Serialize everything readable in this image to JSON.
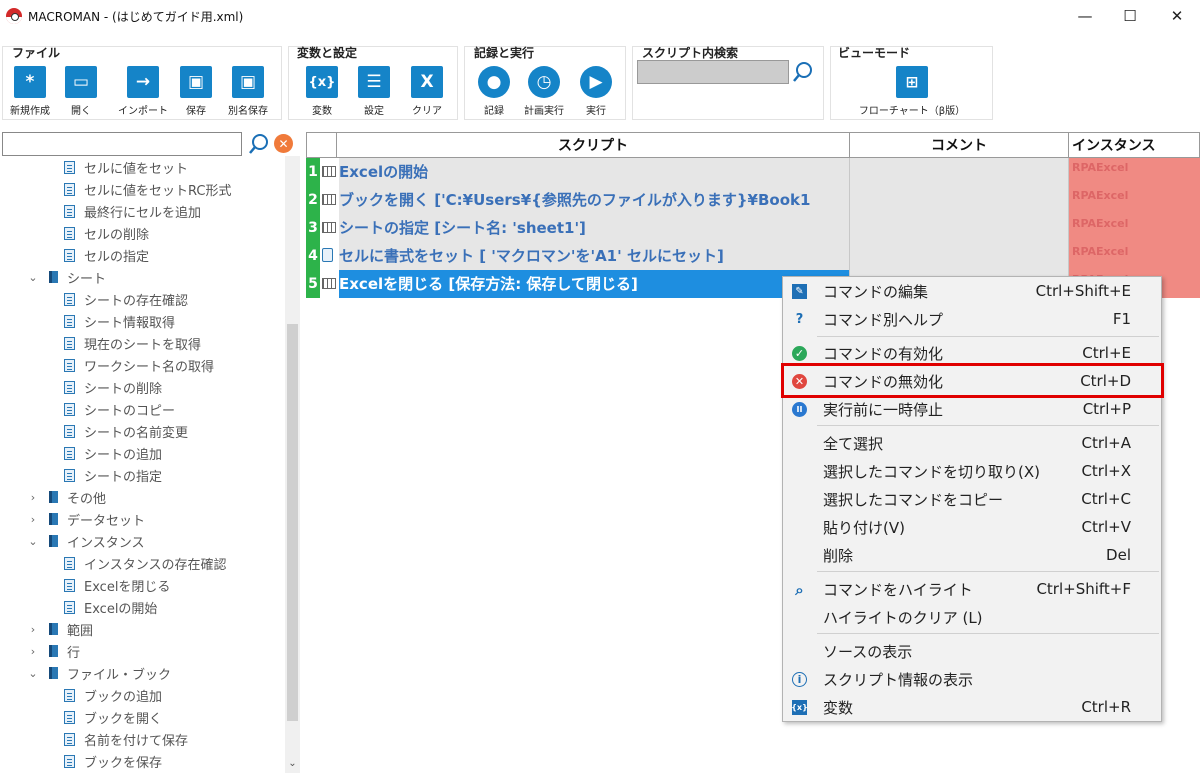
{
  "window": {
    "title": "MACROMAN - (はじめてガイド用.xml)",
    "controls": {
      "minimize": "—",
      "maximize": "☐",
      "close": "✕"
    }
  },
  "ribbon": {
    "groups": [
      {
        "title": "ファイル",
        "buttons": [
          {
            "label": "新規作成",
            "icon": "*"
          },
          {
            "label": "開く",
            "icon": "▭"
          },
          {
            "label": "インポート",
            "icon": "→"
          },
          {
            "label": "保存",
            "icon": "▣"
          },
          {
            "label": "別名保存",
            "icon": "▣"
          }
        ]
      },
      {
        "title": "変数と設定",
        "buttons": [
          {
            "label": "変数",
            "icon": "{x}"
          },
          {
            "label": "設定",
            "icon": "☰"
          },
          {
            "label": "クリア",
            "icon": "X"
          }
        ]
      },
      {
        "title": "記録と実行",
        "buttons": [
          {
            "label": "記録",
            "icon": "●"
          },
          {
            "label": "計画実行",
            "icon": "◷"
          },
          {
            "label": "実行",
            "icon": "▶"
          }
        ]
      },
      {
        "title": "スクリプト内検索"
      },
      {
        "title": "ビューモード",
        "buttons": [
          {
            "label": "フローチャート（β版）",
            "icon": "⊞"
          }
        ]
      }
    ]
  },
  "tree": {
    "items": [
      {
        "label": "セルに値をセット",
        "level": 2,
        "kind": "doc"
      },
      {
        "label": "セルに値をセットRC形式",
        "level": 2,
        "kind": "doc"
      },
      {
        "label": "最終行にセルを追加",
        "level": 2,
        "kind": "doc"
      },
      {
        "label": "セルの削除",
        "level": 2,
        "kind": "doc"
      },
      {
        "label": "セルの指定",
        "level": 2,
        "kind": "doc"
      },
      {
        "label": "シート",
        "level": 1,
        "kind": "folder",
        "arrow": "⌄"
      },
      {
        "label": "シートの存在確認",
        "level": 2,
        "kind": "doc"
      },
      {
        "label": "シート情報取得",
        "level": 2,
        "kind": "doc"
      },
      {
        "label": "現在のシートを取得",
        "level": 2,
        "kind": "doc"
      },
      {
        "label": "ワークシート名の取得",
        "level": 2,
        "kind": "doc"
      },
      {
        "label": "シートの削除",
        "level": 2,
        "kind": "doc"
      },
      {
        "label": "シートのコピー",
        "level": 2,
        "kind": "doc"
      },
      {
        "label": "シートの名前変更",
        "level": 2,
        "kind": "doc"
      },
      {
        "label": "シートの追加",
        "level": 2,
        "kind": "doc"
      },
      {
        "label": "シートの指定",
        "level": 2,
        "kind": "doc"
      },
      {
        "label": "その他",
        "level": 1,
        "kind": "folder",
        "arrow": "›"
      },
      {
        "label": "データセット",
        "level": 1,
        "kind": "folder",
        "arrow": "›"
      },
      {
        "label": "インスタンス",
        "level": 1,
        "kind": "folder",
        "arrow": "⌄"
      },
      {
        "label": "インスタンスの存在確認",
        "level": 2,
        "kind": "doc"
      },
      {
        "label": "Excelを閉じる",
        "level": 2,
        "kind": "doc"
      },
      {
        "label": "Excelの開始",
        "level": 2,
        "kind": "doc"
      },
      {
        "label": "範囲",
        "level": 1,
        "kind": "folder",
        "arrow": "›"
      },
      {
        "label": "行",
        "level": 1,
        "kind": "folder",
        "arrow": "›"
      },
      {
        "label": "ファイル・ブック",
        "level": 1,
        "kind": "folder",
        "arrow": "⌄"
      },
      {
        "label": "ブックの追加",
        "level": 2,
        "kind": "doc"
      },
      {
        "label": "ブックを開く",
        "level": 2,
        "kind": "doc"
      },
      {
        "label": "名前を付けて保存",
        "level": 2,
        "kind": "doc"
      },
      {
        "label": "ブックを保存",
        "level": 2,
        "kind": "doc"
      }
    ]
  },
  "grid": {
    "headers": {
      "script": "スクリプト",
      "comment": "コメント",
      "instance": "インスタンス"
    },
    "rows": [
      {
        "num": "1",
        "text": "Excelの開始",
        "instance": "RPAExcel",
        "icon": "grid"
      },
      {
        "num": "2",
        "text": "ブックを開く ['C:¥Users¥{参照先のファイルが入ります}¥Book1",
        "instance": "RPAExcel",
        "icon": "grid"
      },
      {
        "num": "3",
        "text": "シートの指定 [シート名: 'sheet1']",
        "instance": "RPAExcel",
        "icon": "grid"
      },
      {
        "num": "4",
        "text": "セルに書式をセット [ 'マクロマン'を'A1' セルにセット]",
        "instance": "RPAExcel",
        "icon": "doc"
      },
      {
        "num": "5",
        "text": "Excelを閉じる [保存方法: 保存して閉じる]",
        "instance": "RPAExcel",
        "icon": "grid",
        "selected": true
      }
    ]
  },
  "context_menu": {
    "items": [
      {
        "label": "コマンドの編集",
        "shortcut": "Ctrl+Shift+E",
        "icon": "edit-icon",
        "color": "#1e6fb5"
      },
      {
        "label": "コマンド別ヘルプ",
        "shortcut": "F1",
        "icon": "help-icon",
        "color": "#1e6fb5"
      },
      {
        "label": "コマンドの有効化",
        "shortcut": "Ctrl+E",
        "icon": "check-icon",
        "color": "#2ca85a"
      },
      {
        "label": "コマンドの無効化",
        "shortcut": "Ctrl+D",
        "icon": "disable-icon",
        "color": "#e0473f"
      },
      {
        "label": "実行前に一時停止",
        "shortcut": "Ctrl+P",
        "icon": "pause-icon",
        "color": "#2a78d0"
      },
      {
        "label": "全て選択",
        "shortcut": "Ctrl+A"
      },
      {
        "label": "選択したコマンドを切り取り(X)",
        "shortcut": "Ctrl+X"
      },
      {
        "label": "選択したコマンドをコピー",
        "shortcut": "Ctrl+C"
      },
      {
        "label": "貼り付け(V)",
        "shortcut": "Ctrl+V"
      },
      {
        "label": "削除",
        "shortcut": "Del"
      },
      {
        "label": "コマンドをハイライト",
        "shortcut": "Ctrl+Shift+F",
        "icon": "search-icon",
        "color": "#1e6fb5"
      },
      {
        "label": "ハイライトのクリア (L)",
        "shortcut": ""
      },
      {
        "label": "ソースの表示",
        "shortcut": ""
      },
      {
        "label": "スクリプト情報の表示",
        "shortcut": "",
        "icon": "info-icon",
        "color": "#1e6fb5"
      },
      {
        "label": "変数",
        "shortcut": "Ctrl+R",
        "icon": "variable-icon",
        "color": "#1e6fb5"
      }
    ]
  }
}
